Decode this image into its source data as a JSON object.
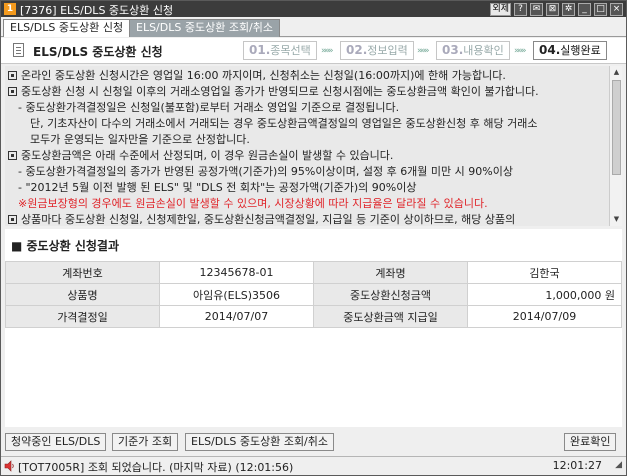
{
  "window": {
    "title": "[7376] ELS/DLS 중도상환 신청",
    "app_badge": "1",
    "controls": [
      "외제",
      "?",
      "✉",
      "⊠",
      "✲",
      "_",
      "□",
      "×"
    ]
  },
  "tabs": [
    {
      "label": "ELS/DLS 중도상환 신청",
      "active": true
    },
    {
      "label": "ELS/DLS 중도상환 조회/취소",
      "active": false
    }
  ],
  "header": {
    "title": "ELS/DLS 중도상환 신청",
    "steps": [
      {
        "num": "01.",
        "label": "종목선택"
      },
      {
        "num": "02.",
        "label": "정보입력"
      },
      {
        "num": "03.",
        "label": "내용확인"
      },
      {
        "num": "04.",
        "label": "실행완료"
      }
    ],
    "arrow": "»»»"
  },
  "notice": {
    "lines": [
      {
        "bullet": true,
        "text": "온라인 중도상환 신청시간은 영업일 16:00 까지이며, 신청취소는 신청일(16:00까지)에 한해 가능합니다.",
        "red": false,
        "indent": 0
      },
      {
        "bullet": true,
        "text": "중도상환 신청 시 신청일 이후의 거래소영업일 종가가 반영되므로 신청시점에는 중도상환금액 확인이 불가합니다.",
        "red": false,
        "indent": 0
      },
      {
        "bullet": false,
        "text": "- 중도상환가격결정일은 신청일(불포함)로부터 거래소 영업일 기준으로 결정됩니다.",
        "red": false,
        "indent": 1
      },
      {
        "bullet": false,
        "text": "단, 기초자산이 다수의 거래소에서 거래되는 경우 중도상환금액결정일의 영업일은 중도상환신청 후 해당 거래소",
        "red": false,
        "indent": 2
      },
      {
        "bullet": false,
        "text": "모두가 운영되는 일자만을 기준으로 산정합니다.",
        "red": false,
        "indent": 2
      },
      {
        "bullet": true,
        "text": "중도상환금액은 아래 수준에서 산정되며, 이 경우 원금손실이 발생할 수 있습니다.",
        "red": false,
        "indent": 0
      },
      {
        "bullet": false,
        "text": "- 중도상환가격결정일의 종가가 반영된 공정가액(기준가)의 95%이상이며, 설정 후 6개월 미만 시 90%이상",
        "red": false,
        "indent": 1
      },
      {
        "bullet": false,
        "text": "- \"2012년 5월 이전 발행 된 ELS\" 및 \"DLS 전 회차\"는 공정가액(기준가)의 90%이상",
        "red": false,
        "indent": 1
      },
      {
        "bullet": false,
        "text": "※원금보장형의 경우에도 원금손실이 발생할 수 있으며, 시장상황에 따라 지급율은 달라질 수 있습니다.",
        "red": true,
        "indent": 1
      },
      {
        "bullet": true,
        "text": "상품마다 중도상환 신청일, 신청제한일, 중도상환신청금액결정일, 지급일 등 기준이 상이하므로, 해당 상품의",
        "red": false,
        "indent": 0
      }
    ]
  },
  "result": {
    "title": "■ 중도상환 신청결과",
    "rows": [
      [
        {
          "k": "계좌번호",
          "v": "12345678-01"
        },
        {
          "k": "계좌명",
          "v": "김한국"
        }
      ],
      [
        {
          "k": "상품명",
          "v": "아임유(ELS)3506"
        },
        {
          "k": "중도상환신청금액",
          "v": "1,000,000 원"
        }
      ],
      [
        {
          "k": "가격결정일",
          "v": "2014/07/07"
        },
        {
          "k": "중도상환금액 지급일",
          "v": "2014/07/09"
        }
      ]
    ]
  },
  "buttons": {
    "pending": "청약중인 ELS/DLS",
    "base_price": "기준가 조회",
    "inquiry_cancel": "ELS/DLS 중도상환 조회/취소",
    "confirm": "완료확인"
  },
  "status": {
    "message": "[TOT7005R] 조회 되었습니다. (마지막 자료) (12:01:56)",
    "time": "12:01:27",
    "icon": "speaker-icon"
  },
  "colors": {
    "title_bar": "#3c3c3c",
    "app_icon": "#f39a1e",
    "warning_red": "#e0252a",
    "active_step": "#111111"
  }
}
